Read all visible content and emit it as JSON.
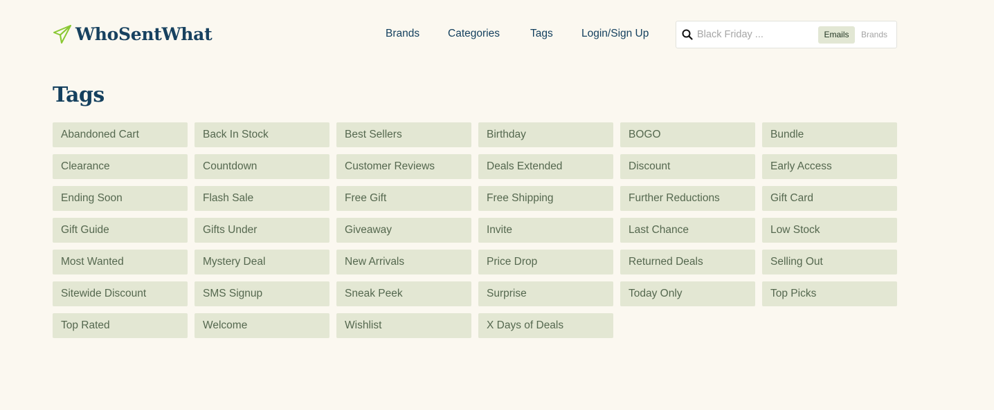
{
  "brand": {
    "name": "WhoSentWhat",
    "accent_color": "#8ac833",
    "text_color": "#17415f"
  },
  "nav": {
    "items": [
      {
        "label": "Brands"
      },
      {
        "label": "Categories"
      },
      {
        "label": "Tags"
      },
      {
        "label": "Login/Sign Up"
      }
    ]
  },
  "search": {
    "icon": "search-icon",
    "placeholder": "Black Friday ...",
    "value": "",
    "toggle": {
      "emails_label": "Emails",
      "brands_label": "Brands",
      "selected": "Emails"
    }
  },
  "page": {
    "title": "Tags",
    "background": "#fbf8f0",
    "tag_background": "#e3e7d3"
  },
  "tags": [
    "Abandoned Cart",
    "Back In Stock",
    "Best Sellers",
    "Birthday",
    "BOGO",
    "Bundle",
    "Clearance",
    "Countdown",
    "Customer Reviews",
    "Deals Extended",
    "Discount",
    "Early Access",
    "Ending Soon",
    "Flash Sale",
    "Free Gift",
    "Free Shipping",
    "Further Reductions",
    "Gift Card",
    "Gift Guide",
    "Gifts Under",
    "Giveaway",
    "Invite",
    "Last Chance",
    "Low Stock",
    "Most Wanted",
    "Mystery Deal",
    "New Arrivals",
    "Price Drop",
    "Returned Deals",
    "Selling Out",
    "Sitewide Discount",
    "SMS Signup",
    "Sneak Peek",
    "Surprise",
    "Today Only",
    "Top Picks",
    "Top Rated",
    "Welcome",
    "Wishlist",
    "X Days of Deals"
  ]
}
